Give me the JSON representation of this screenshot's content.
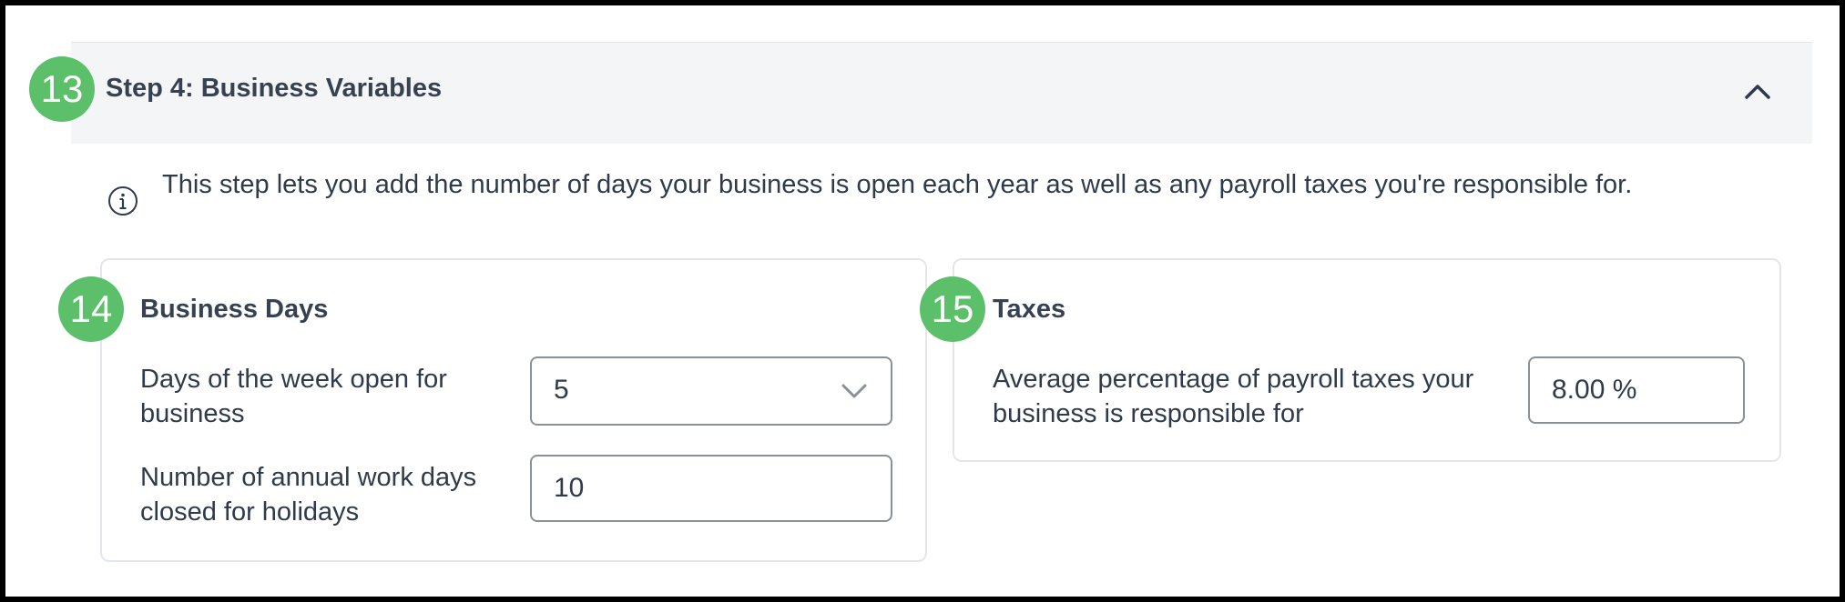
{
  "step": {
    "badge": "13",
    "title": "Step 4: Business Variables",
    "collapse_icon": "chevron-up-icon"
  },
  "info": {
    "icon": "info-circle-icon",
    "text": "This step lets you add the number of days your business is open each year as well as any payroll taxes you're responsible for."
  },
  "business_days": {
    "badge": "14",
    "title": "Business Days",
    "days_open_label": "Days of the week open for business",
    "days_open_value": "5",
    "holidays_label": "Number of annual work days closed for holidays",
    "holidays_value": "10"
  },
  "taxes": {
    "badge": "15",
    "title": "Taxes",
    "payroll_label": "Average percentage of payroll taxes your business is responsible for",
    "payroll_value": "8.00 %"
  },
  "colors": {
    "badge": "#5cbf6a",
    "header_bg": "#f4f5f7",
    "text": "#2f3a4a"
  }
}
